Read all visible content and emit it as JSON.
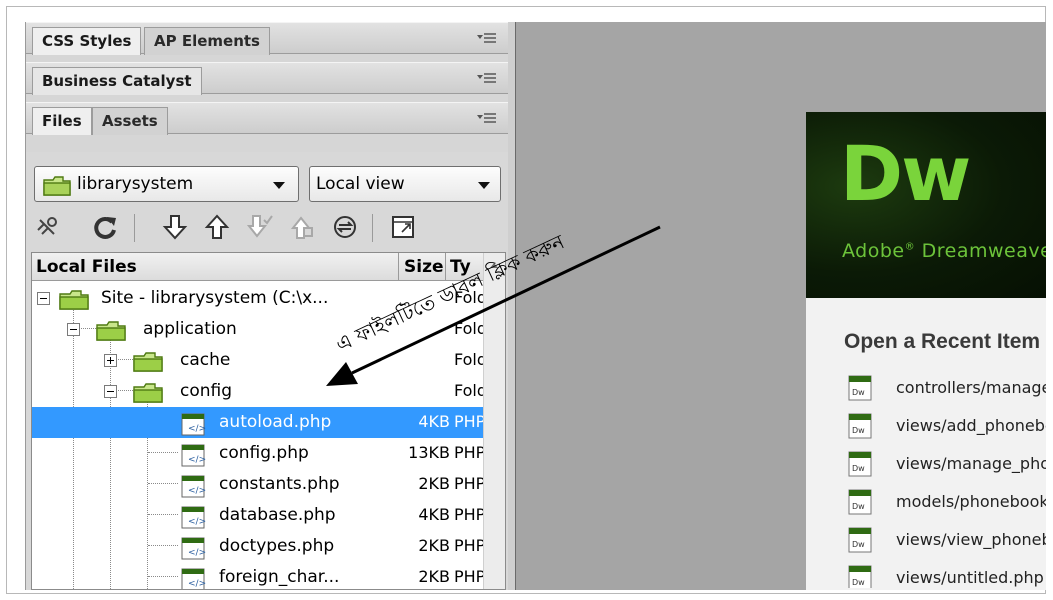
{
  "panels": {
    "row1_tabs": [
      "CSS Styles",
      "AP Elements"
    ],
    "row2_tabs": [
      "Business Catalyst"
    ],
    "row3_tabs": [
      "Files",
      "Assets"
    ]
  },
  "files": {
    "site_dropdown": "librarysystem",
    "view_dropdown": "Local view",
    "toolbar_icons": [
      "connect-icon",
      "refresh-icon",
      "get-files-icon",
      "put-files-icon",
      "check-out-icon",
      "check-in-icon",
      "synchronize-icon",
      "expand-icon"
    ],
    "columns": {
      "local": "Local Files",
      "size": "Size",
      "type": "Ty"
    },
    "tree": [
      {
        "name": "Site - librarysystem (C:\\x...",
        "size": "",
        "type": "Folder",
        "kind": "site"
      },
      {
        "name": "application",
        "size": "",
        "type": "Folder",
        "kind": "folder"
      },
      {
        "name": "cache",
        "size": "",
        "type": "Folder",
        "kind": "folder"
      },
      {
        "name": "config",
        "size": "",
        "type": "Folder",
        "kind": "folder"
      },
      {
        "name": "autoload.php",
        "size": "4KB",
        "type": "PHP",
        "kind": "php",
        "selected": true
      },
      {
        "name": "config.php",
        "size": "13KB",
        "type": "PHP",
        "kind": "php"
      },
      {
        "name": "constants.php",
        "size": "2KB",
        "type": "PHP",
        "kind": "php"
      },
      {
        "name": "database.php",
        "size": "4KB",
        "type": "PHP",
        "kind": "php"
      },
      {
        "name": "doctypes.php",
        "size": "2KB",
        "type": "PHP",
        "kind": "php"
      },
      {
        "name": "foreign_char...",
        "size": "2KB",
        "type": "PHP",
        "kind": "php"
      }
    ]
  },
  "welcome": {
    "logo": "Dw",
    "product": "Adobe",
    "product_rest": "Dreamweaver",
    "recent_title": "Open a Recent Item",
    "recent_items": [
      "controllers/manage_phonebook.php",
      "views/add_phonebook.php",
      "views/manage_phonebook.php",
      "models/phonebook_model.php",
      "views/view_phonebook.php",
      "views/untitled.php"
    ]
  },
  "annotation": {
    "text": "এ ফাইলটিতে ডাবল ক্লিক করুন"
  },
  "colors": {
    "selection": "#3399ff",
    "dw_green": "#7ad43b",
    "stage": "#a5a5a5"
  }
}
